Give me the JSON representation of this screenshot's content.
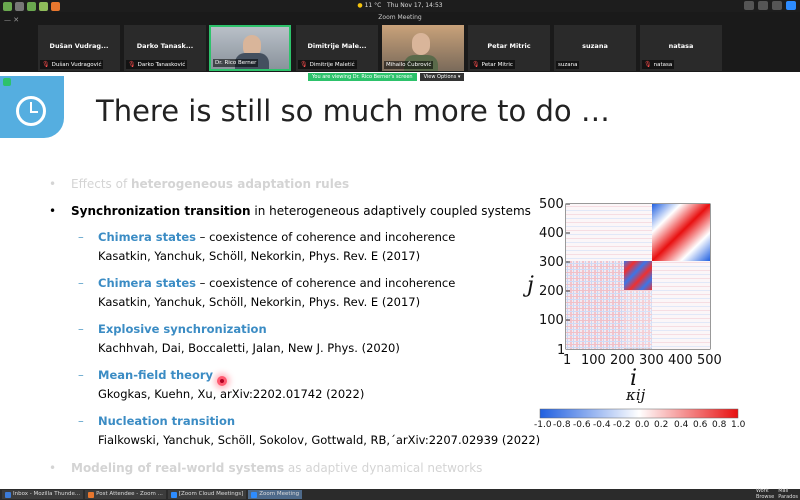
{
  "system": {
    "weather": "11 °C",
    "datetime": "Thu Nov 17, 14:53"
  },
  "zoom": {
    "window_title": "Zoom Meeting",
    "viewing_banner": "You are viewing Dr. Rico Berner's screen",
    "view_options": "View Options ▾"
  },
  "participants": [
    {
      "name": "Dušan Vudrag...",
      "label": "Dušan Vudragović",
      "muted": true
    },
    {
      "name": "Darko Tanask...",
      "label": "Darko Tanasković",
      "muted": true
    },
    {
      "name": "",
      "label": "Dr. Rico Berner",
      "muted": false,
      "video": true,
      "active": true
    },
    {
      "name": "Dimitrije Male...",
      "label": "Dimitrije Maletić",
      "muted": true
    },
    {
      "name": "",
      "label": "Mihailo Čubrović",
      "muted": false,
      "video": true
    },
    {
      "name": "Petar Mitric",
      "label": "Petar Mitric",
      "muted": true
    },
    {
      "name": "suzana",
      "label": "suzana",
      "muted": false
    },
    {
      "name": "natasa",
      "label": "natasa",
      "muted": true
    }
  ],
  "slide": {
    "title": "There is still so much more to do …",
    "bullet_faded_1_pre": "Effects of ",
    "bullet_faded_1_bold": "heterogeneous adaptation rules",
    "bullet_main_bold": "Synchronization transition",
    "bullet_main_rest": " in heterogeneous adaptively coupled systems",
    "items": [
      {
        "head": "Chimera states",
        "tail": " – coexistence of coherence and incoherence",
        "ref": "Kasatkin, Yanchuk, Schöll, Nekorkin, Phys. Rev. E (2017)"
      },
      {
        "head": "Chimera states",
        "tail": " – coexistence of coherence and incoherence",
        "ref": "Kasatkin, Yanchuk, Schöll, Nekorkin, Phys. Rev. E (2017)"
      },
      {
        "head": "Explosive synchronization",
        "tail": "",
        "ref": "Kachhvah, Dai, Boccaletti, Jalan, New J. Phys. (2020)"
      },
      {
        "head": "Mean-field theory",
        "tail": "",
        "ref": "Gkogkas, Kuehn, Xu, arXiv:2202.01742 (2022)"
      },
      {
        "head": "Nucleation transition",
        "tail": "",
        "ref": "Fialkowski, Yanchuk, Schöll, Sokolov, Gottwald, RB,´arXiv:2207.02939 (2022)"
      }
    ],
    "bullet_faded_2_bold": "Modeling of real-world systems",
    "bullet_faded_2_rest": " as adaptive dynamical networks"
  },
  "chart_data": {
    "type": "heatmap",
    "xlabel": "i",
    "ylabel": "j",
    "x_ticks": [
      "1",
      "100",
      "200",
      "300",
      "400",
      "500"
    ],
    "y_ticks": [
      "1",
      "100",
      "200",
      "300",
      "400",
      "500"
    ],
    "colorbar_label": "κij",
    "colorbar_ticks": [
      "-1.0",
      "-0.8",
      "-0.6",
      "-0.4",
      "-0.2",
      "0.0",
      "0.2",
      "0.4",
      "0.6",
      "0.8",
      "1.0"
    ],
    "clim": [
      -1.0,
      1.0
    ],
    "colormap": [
      "#1f5fe0",
      "#ffffff",
      "#e81010"
    ]
  },
  "taskbar": {
    "tasks": [
      {
        "label": "Inbox - Mozilla Thunde...",
        "color": "#3c7bd8"
      },
      {
        "label": "Post Attendee - Zoom ...",
        "color": "#e8772e"
      },
      {
        "label": "[Zoom Cloud Meetings]",
        "color": "#2d8cff"
      },
      {
        "label": "Zoom Meeting",
        "color": "#2d8cff",
        "active": true
      }
    ],
    "ws1": "Work",
    "ws2": "Mail",
    "ws3": "Browse",
    "ws4": "Parados"
  }
}
